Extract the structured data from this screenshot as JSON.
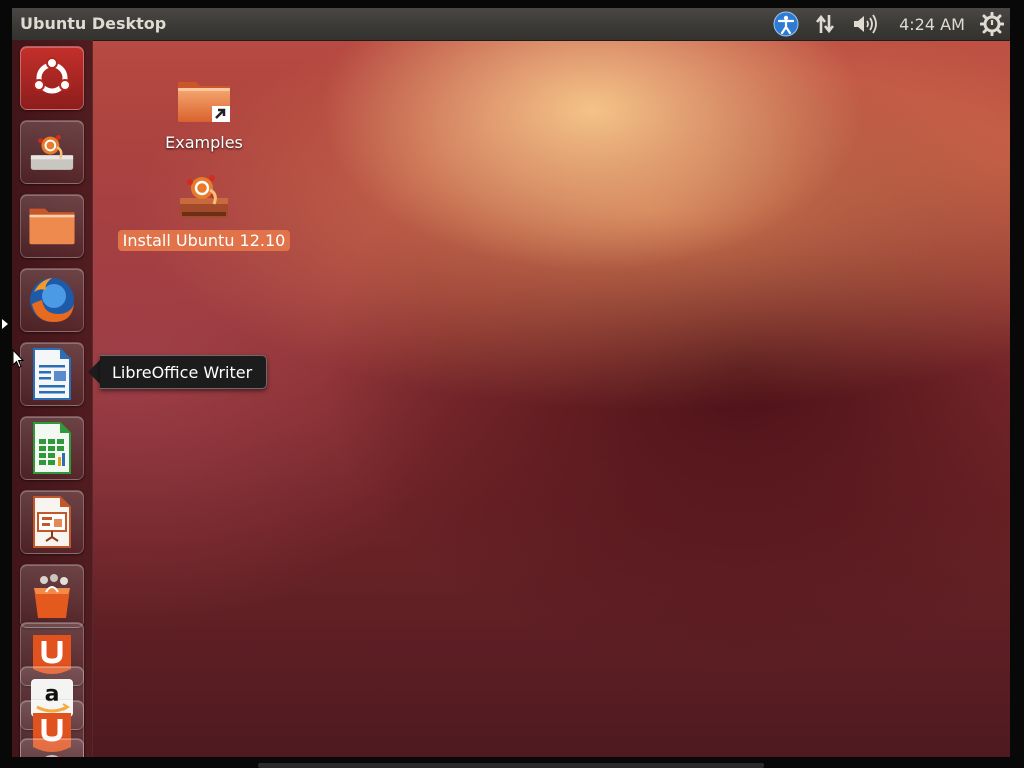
{
  "panel": {
    "title": "Ubuntu Desktop",
    "clock": "4:24 AM",
    "indicators": [
      "accessibility-icon",
      "network-icon",
      "sound-icon",
      "session-gear-icon"
    ]
  },
  "desktop": {
    "icons": [
      {
        "label": "Examples",
        "icon": "folder-link-icon",
        "selected": false
      },
      {
        "label": "Install Ubuntu 12.10",
        "icon": "installer-icon",
        "selected": true
      }
    ]
  },
  "launcher": {
    "items": [
      {
        "name": "dash-home",
        "icon": "ubuntu-logo-icon"
      },
      {
        "name": "install-ubuntu",
        "icon": "installer-icon"
      },
      {
        "name": "home-folder",
        "icon": "folder-icon"
      },
      {
        "name": "firefox",
        "icon": "firefox-icon"
      },
      {
        "name": "libreoffice-writer",
        "icon": "writer-icon"
      },
      {
        "name": "libreoffice-calc",
        "icon": "calc-icon"
      },
      {
        "name": "libreoffice-impress",
        "icon": "impress-icon"
      },
      {
        "name": "software-center",
        "icon": "shopping-bag-icon"
      },
      {
        "name": "ubuntu-one",
        "icon": "ubuntu-one-icon"
      },
      {
        "name": "amazon",
        "icon": "amazon-icon"
      },
      {
        "name": "ubuntu-one-music",
        "icon": "ubuntu-one-icon"
      },
      {
        "name": "system-settings",
        "icon": "settings-icon"
      }
    ]
  },
  "tooltip": {
    "text": "LibreOffice Writer"
  },
  "colors": {
    "panel_bg": "#3a3935",
    "selection": "#e0734a",
    "launcher_bg": "#4a161a"
  }
}
